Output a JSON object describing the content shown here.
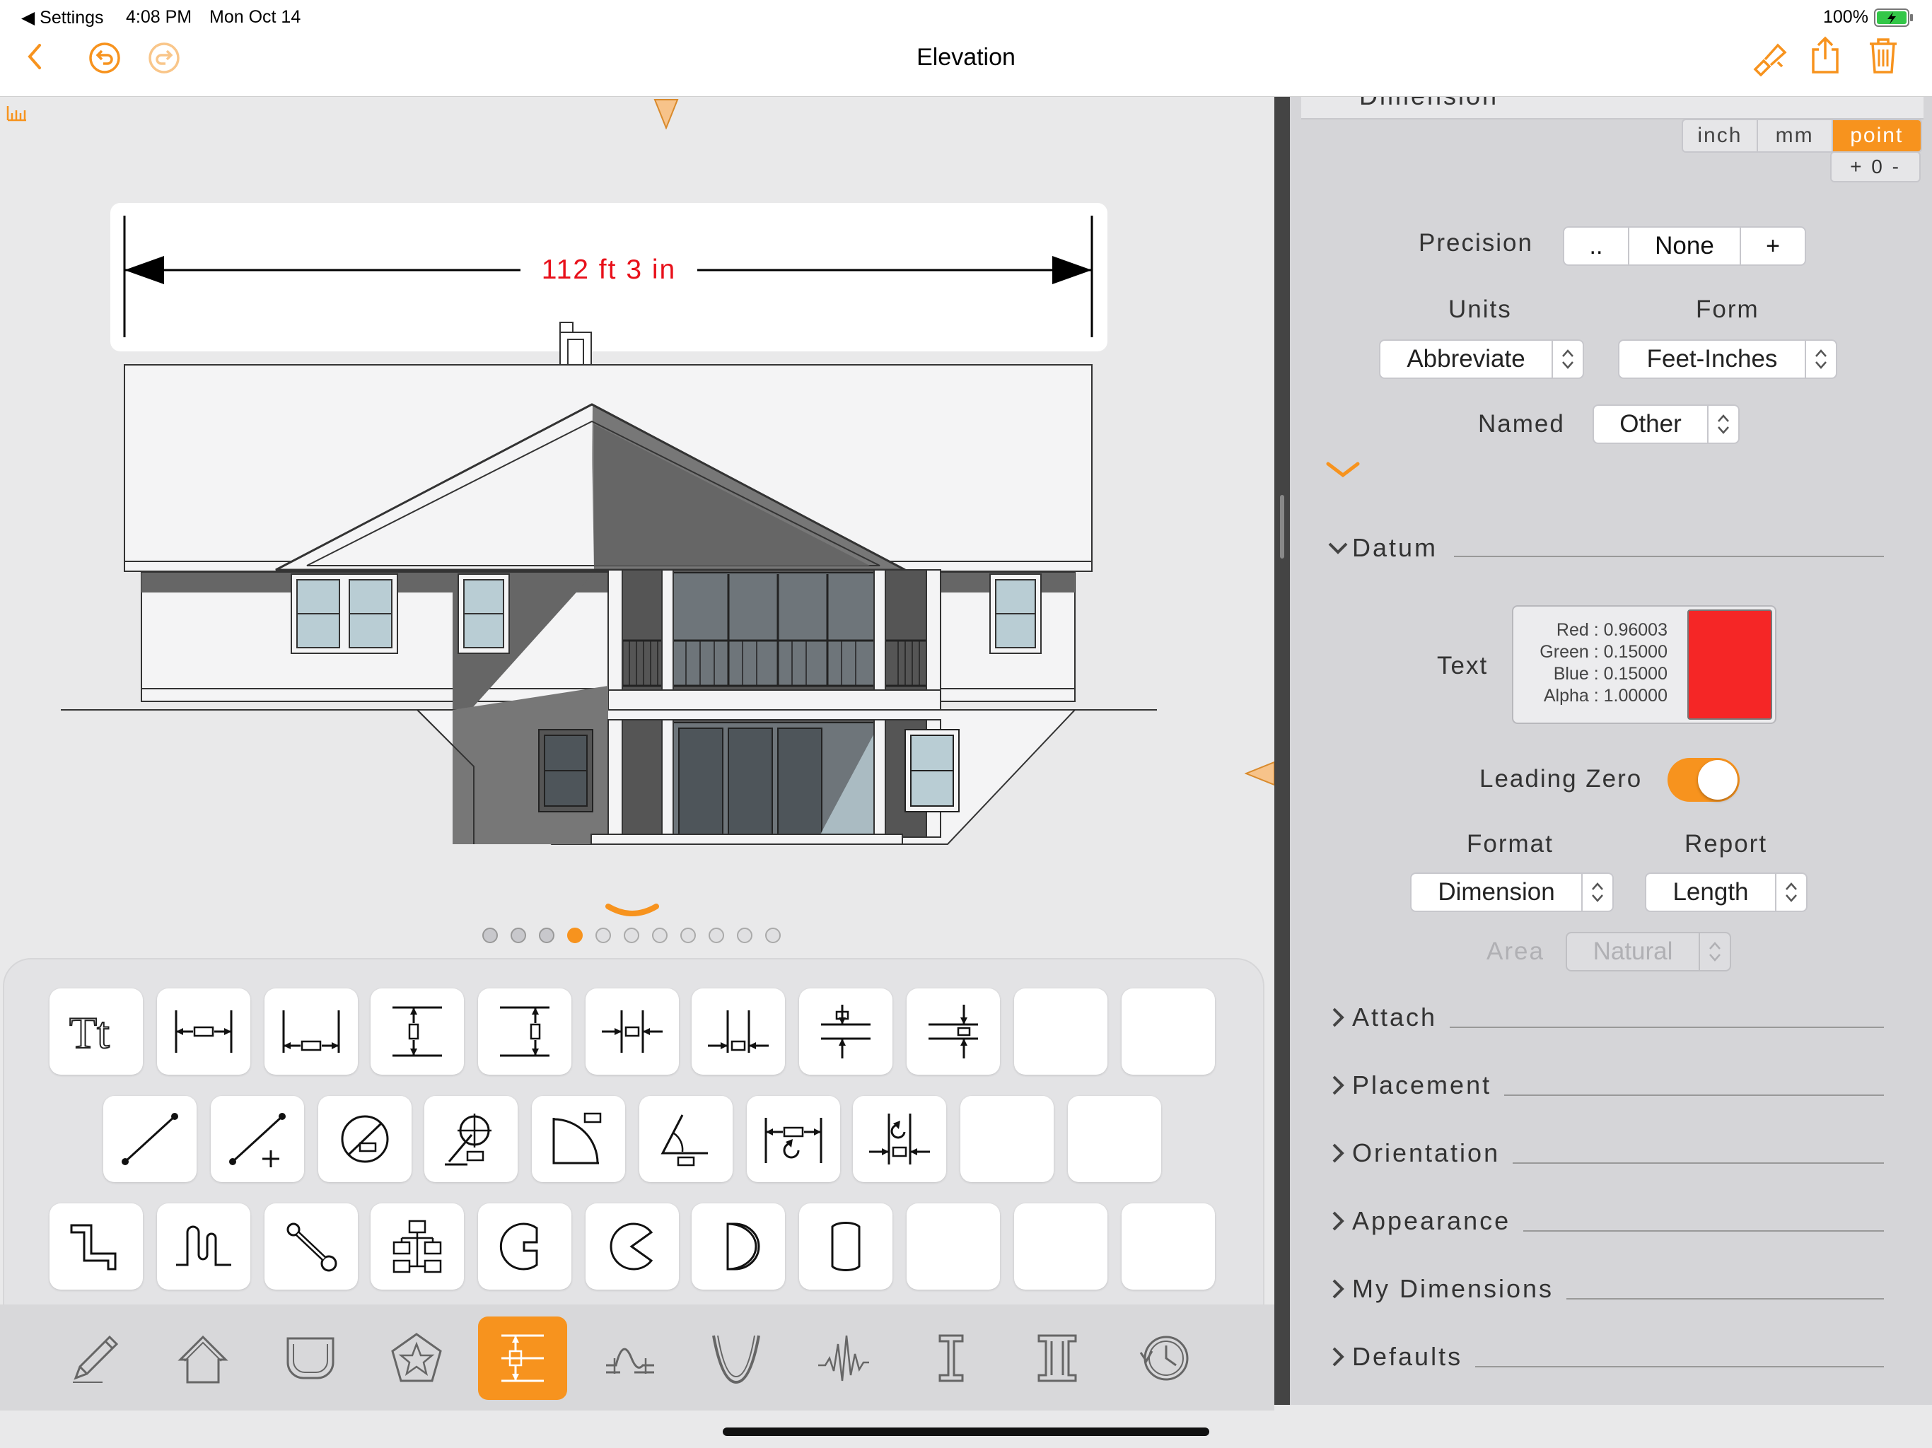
{
  "status": {
    "back_app": "◀ Settings",
    "time": "4:08 PM",
    "date": "Mon Oct 14",
    "battery": "100%"
  },
  "nav": {
    "title": "Elevation"
  },
  "drawing": {
    "dimension_text": "112 ft 3 in"
  },
  "panel": {
    "section_title_partial": "Dimension",
    "unit_tabs": [
      "inch",
      "mm",
      "point"
    ],
    "unit_selected": "point",
    "stepper": "+ 0 -",
    "precision": {
      "label": "Precision",
      "segments": [
        "..",
        "None",
        "+"
      ]
    },
    "units": {
      "label": "Units",
      "value": "Abbreviate"
    },
    "form": {
      "label": "Form",
      "value": "Feet-Inches"
    },
    "named": {
      "label": "Named",
      "value": "Other"
    },
    "datum": {
      "label": "Datum"
    },
    "text_color": {
      "label": "Text",
      "red": "Red : 0.96003",
      "green": "Green : 0.15000",
      "blue": "Blue : 0.15000",
      "alpha": "Alpha : 1.00000",
      "swatch": "#f52626"
    },
    "leading_zero": {
      "label": "Leading Zero",
      "on": true
    },
    "format": {
      "label": "Format",
      "value": "Dimension"
    },
    "report": {
      "label": "Report",
      "value": "Length"
    },
    "area": {
      "label": "Area",
      "value": "Natural"
    },
    "sections": [
      "Attach",
      "Placement",
      "Orientation",
      "Appearance",
      "My Dimensions",
      "Defaults"
    ]
  },
  "colors": {
    "accent": "#f7931e",
    "dimension_red": "#e8101a"
  },
  "pager": {
    "count": 11,
    "active": 3
  }
}
